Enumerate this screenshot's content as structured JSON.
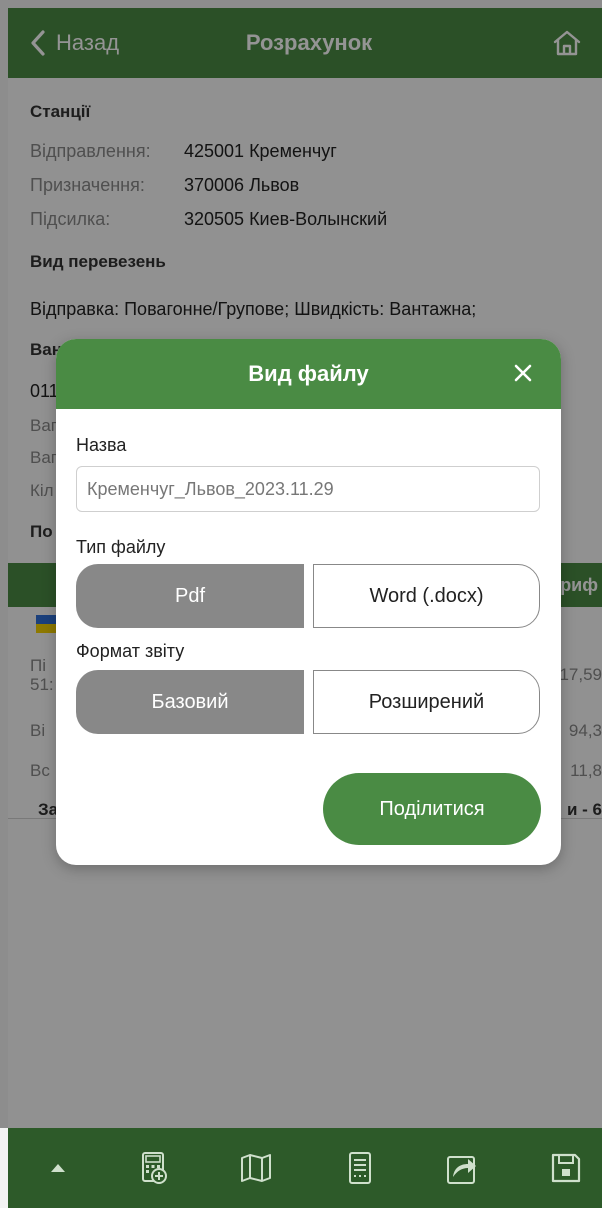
{
  "header": {
    "back_label": "Назад",
    "title": "Розрахунок"
  },
  "stations": {
    "section_title": "Станції",
    "rows": [
      {
        "label": "Відправлення:",
        "value": "425001 Кременчуг"
      },
      {
        "label": "Призначення:",
        "value": "370006 Львов"
      },
      {
        "label": "Підсилка:",
        "value": "320505 Киев-Волынский"
      }
    ]
  },
  "transport": {
    "section_title": "Вид перевезень",
    "text": "Відправка: Повагонне/Групове; Швидкість: Вантажна;"
  },
  "background_fragments": {
    "left": [
      "Ван",
      "011",
      "Ваг",
      "Ваг",
      "Кіл",
      "По",
      "Пі",
      "51:",
      "Ві",
      "Вс",
      "За"
    ],
    "right": [
      "риф",
      "17,59",
      "94,3",
      "11,8",
      "и - 6"
    ]
  },
  "modal": {
    "title": "Вид файлу",
    "name_label": "Назва",
    "name_value": "Кременчуг_Львов_2023.11.29",
    "file_type_label": "Тип файлу",
    "file_type_options": [
      "Pdf",
      "Word (.docx)"
    ],
    "file_type_selected": "Pdf",
    "report_format_label": "Формат звіту",
    "report_format_options": [
      "Базовий",
      "Розширений"
    ],
    "report_format_selected": "Базовий",
    "share_label": "Поділитися"
  },
  "toolbar": {
    "icons": [
      "caret-up-icon",
      "calculator-add-icon",
      "map-icon",
      "document-list-icon",
      "share-icon",
      "save-icon"
    ]
  },
  "colors": {
    "primary_green": "#4a8b44",
    "toolbar_green": "#2d5a29",
    "segment_active": "#888888"
  }
}
